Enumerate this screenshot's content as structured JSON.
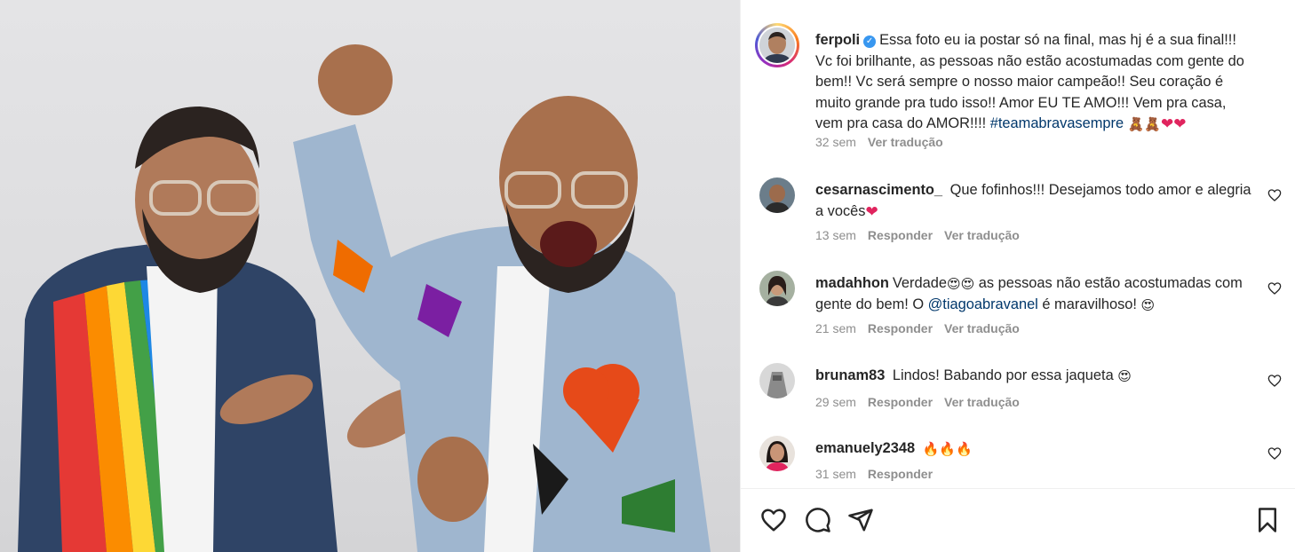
{
  "post": {
    "author": "ferpoli",
    "caption_part1": "Essa foto eu ia postar só na final, mas hj é a sua final!!! Vc foi brilhante, as pessoas não estão acostumadas com gente do bem!! Vc será sempre o nosso maior campeão!! Seu coração é muito grande pra tudo isso!! Amor EU TE AMO!!! Vem pra casa, vem pra casa do AMOR!!!! ",
    "hashtag": "#teamabravasempre",
    "caption_emojis": "🧸🧸",
    "caption_hearts": "❤❤",
    "time": "32 sem",
    "translate": "Ver tradução",
    "icons": {
      "verified": "verified-badge-icon",
      "avatar": "profile-avatar"
    }
  },
  "comments": [
    {
      "user": "cesarnascimento_",
      "text": "Que fofinhos!!! Desejamos todo amor e alegria a vocês",
      "emoji": "❤",
      "time": "13 sem",
      "reply": "Responder",
      "translate": "Ver tradução"
    },
    {
      "user": "madahhon",
      "text_a": "Verdade",
      "emoji_a": "😍😍",
      "text_b": " as pessoas não estão acostumadas com gente do bem! O ",
      "mention": "@tiagoabravanel",
      "text_c": " é maravilhoso! ",
      "emoji_c": "😍",
      "time": "21 sem",
      "reply": "Responder",
      "translate": "Ver tradução"
    },
    {
      "user": "brunam83",
      "text": "Lindos! Babando por essa jaqueta ",
      "emoji": "😍",
      "time": "29 sem",
      "reply": "Responder",
      "translate": "Ver tradução"
    },
    {
      "user": "emanuely2348",
      "text": "",
      "emoji": "🔥🔥🔥",
      "time": "31 sem",
      "reply": "Responder"
    }
  ],
  "actions": {
    "icons": [
      "heart-icon",
      "comment-icon",
      "share-icon",
      "bookmark-icon"
    ]
  },
  "colors": {
    "text": "#262626",
    "muted": "#8e8e8e",
    "link": "#00376b",
    "verified": "#3897f0",
    "heart": "#e0245e"
  }
}
